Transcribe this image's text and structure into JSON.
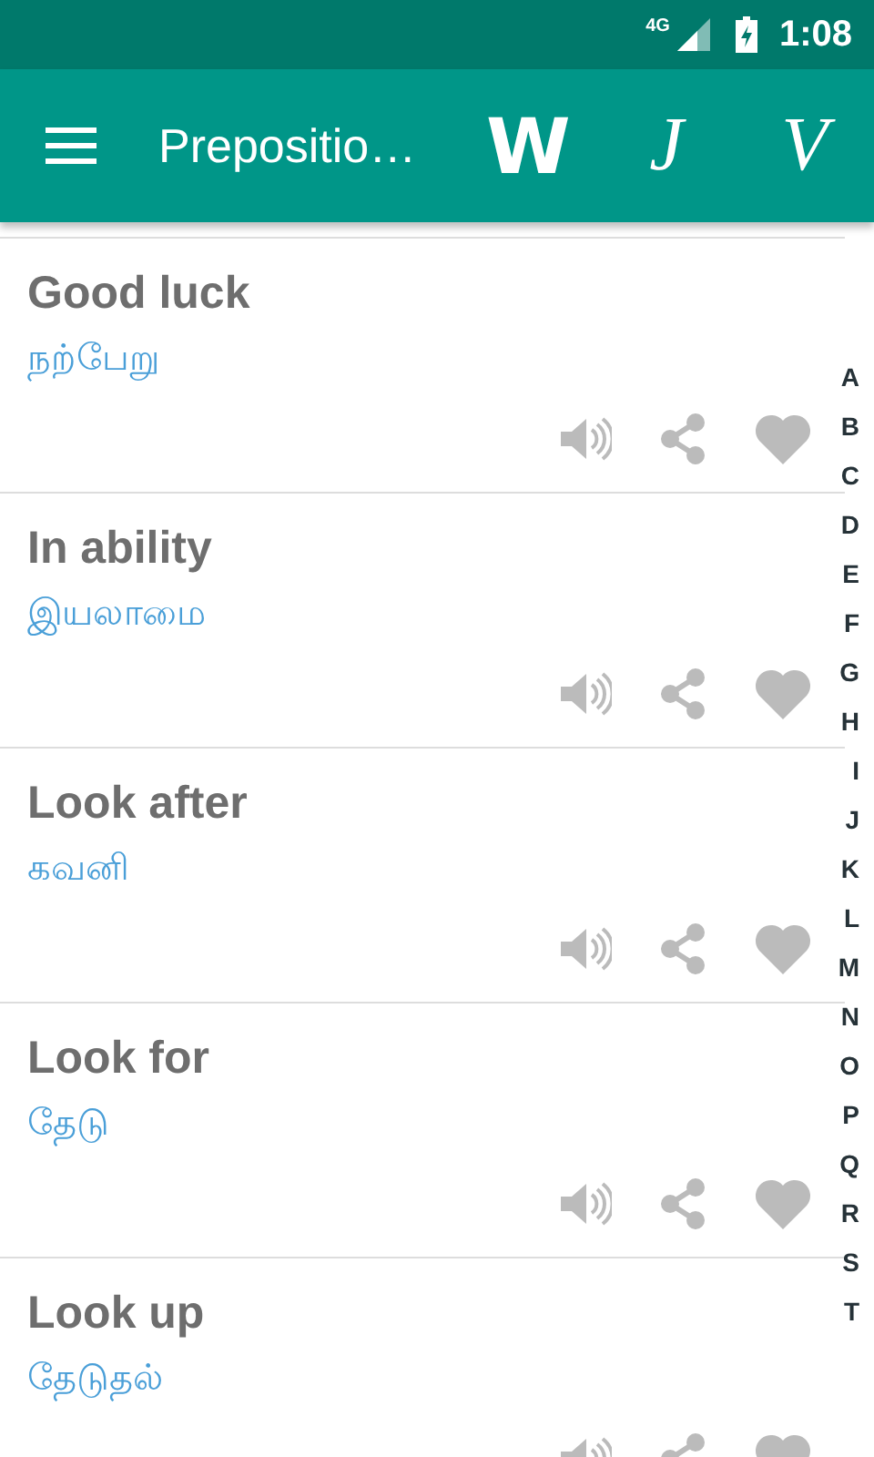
{
  "status_bar": {
    "network": "4G",
    "time": "1:08"
  },
  "app_bar": {
    "title": "Prepositio…",
    "letters": [
      {
        "text": "W",
        "kind": "bold"
      },
      {
        "text": "J",
        "kind": "script"
      },
      {
        "text": "V",
        "kind": "script"
      }
    ]
  },
  "entries": [
    {
      "word": "Good luck",
      "translation": "நற்பேறு",
      "favorite": false
    },
    {
      "word": "In ability",
      "translation": "இயலாமை",
      "favorite": false
    },
    {
      "word": "Look after",
      "translation": "கவனி",
      "favorite": false
    },
    {
      "word": "Look for",
      "translation": "தேடு",
      "favorite": false
    },
    {
      "word": "Look up",
      "translation": "தேடுதல்",
      "favorite": false
    }
  ],
  "index": [
    "A",
    "B",
    "C",
    "D",
    "E",
    "F",
    "G",
    "H",
    "I",
    "J",
    "K",
    "L",
    "M",
    "N",
    "O",
    "P",
    "Q",
    "R",
    "S",
    "T"
  ]
}
